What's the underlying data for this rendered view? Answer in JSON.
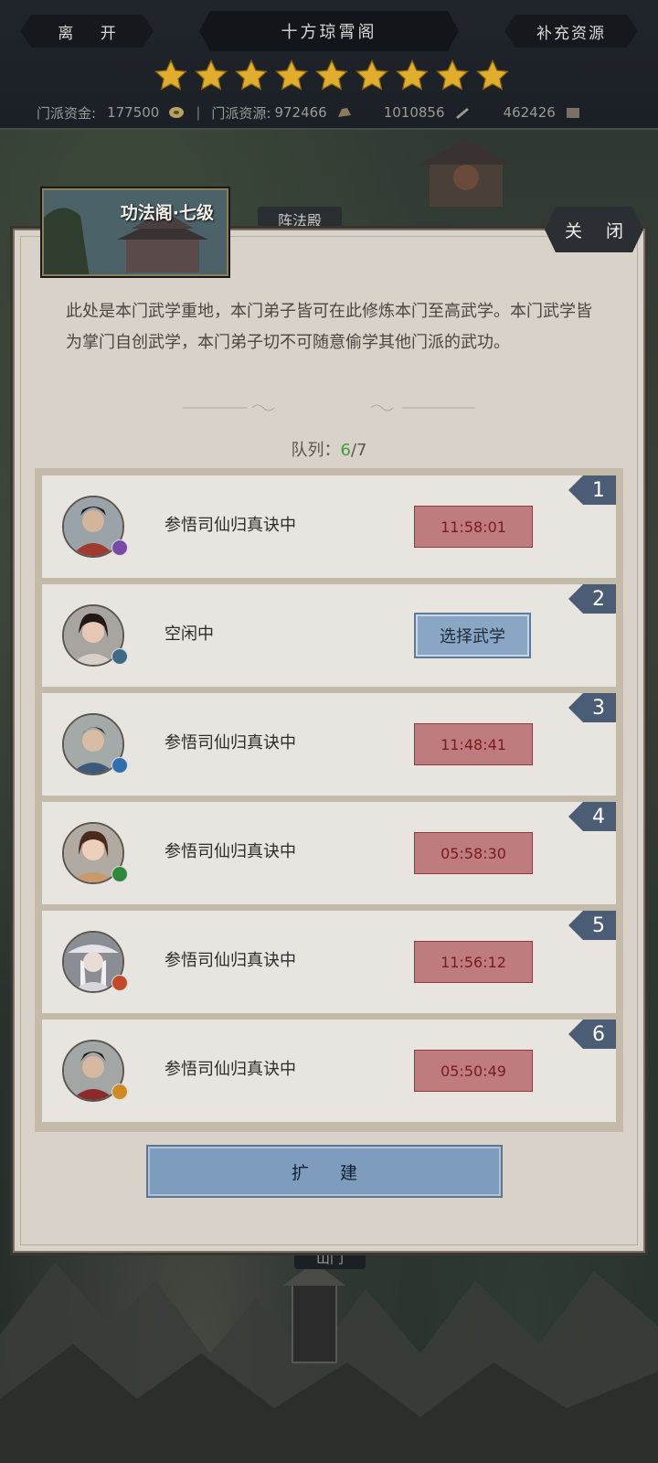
{
  "topbar": {
    "leave_label": "离 开",
    "title": "十方琼霄阁",
    "supply_label": "补充资源",
    "star_count": 9,
    "resources": {
      "funds_label": "门派资金:",
      "funds_value": "177500",
      "res_label": "门派资源:",
      "res_value": "972466",
      "value3": "1010856",
      "value4": "462426"
    }
  },
  "map": {
    "building_label": "阵法殿",
    "gate_label": "山门"
  },
  "panel": {
    "header_title": "功法阁·七级",
    "close_label": "关 闭",
    "description": "此处是本门武学重地，本门弟子皆可在此修炼本门至高武学。本门武学皆为掌门自创武学，本门弟子切不可随意偷学其他门派的武功。",
    "queue_label": "队列：",
    "queue_current": "6",
    "queue_total": "/7",
    "expand_label": "扩 建"
  },
  "slots": [
    {
      "num": "1",
      "status": "参悟司仙归真诀中",
      "timer": "11:58:01",
      "badge_color": "#7a4aa8",
      "accent": "#a0392f"
    },
    {
      "num": "2",
      "status": "空闲中",
      "action": "选择武学",
      "badge_color": "#3e6a88",
      "accent": "#b8a89a"
    },
    {
      "num": "3",
      "status": "参悟司仙归真诀中",
      "timer": "11:48:41",
      "badge_color": "#2f6fb0",
      "accent": "#3c5a78"
    },
    {
      "num": "4",
      "status": "参悟司仙归真诀中",
      "timer": "05:58:30",
      "badge_color": "#2e8a3a",
      "accent": "#c89a6a"
    },
    {
      "num": "5",
      "status": "参悟司仙归真诀中",
      "timer": "11:56:12",
      "badge_color": "#c24a2a",
      "accent": "#d8d8dc"
    },
    {
      "num": "6",
      "status": "参悟司仙归真诀中",
      "timer": "05:50:49",
      "badge_color": "#d08a22",
      "accent": "#8a2a2a"
    }
  ]
}
